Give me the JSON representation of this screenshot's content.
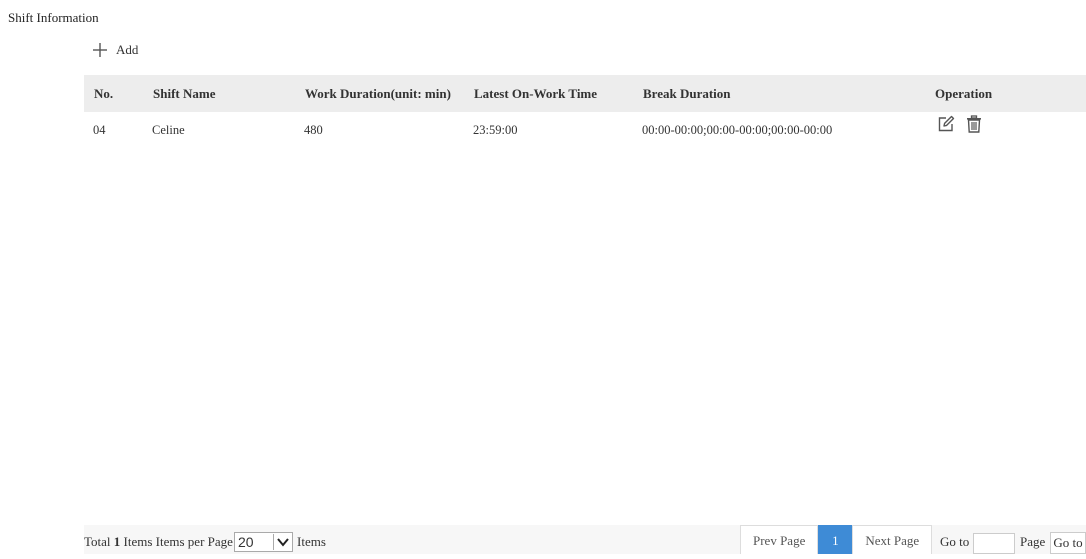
{
  "page": {
    "title": "Shift Information"
  },
  "toolbar": {
    "add_label": "Add"
  },
  "table": {
    "headers": {
      "no": "No.",
      "shift_name": "Shift Name",
      "work_duration": "Work Duration(unit: min)",
      "latest_on_work": "Latest On-Work Time",
      "break_duration": "Break Duration",
      "operation": "Operation"
    },
    "rows": [
      {
        "no": "04",
        "shift_name": "Celine",
        "work_duration": "480",
        "latest_on_work": "23:59:00",
        "break_duration": "00:00-00:00;00:00-00:00;00:00-00:00"
      }
    ]
  },
  "footer": {
    "total_prefix": "Total",
    "total_count": "1",
    "items_per_page_label": "Items Items per Page",
    "per_page_value": "20",
    "items_label": "Items",
    "prev_page": "Prev Page",
    "current_page": "1",
    "next_page": "Next Page",
    "goto_label": "Go to",
    "page_label": "Page",
    "goto_button": "Go to"
  },
  "colors": {
    "accent": "#3e8bd6",
    "header_bg": "#ededed"
  },
  "icons": [
    "plus-icon",
    "edit-icon",
    "delete-icon",
    "chevron-down-icon"
  ]
}
